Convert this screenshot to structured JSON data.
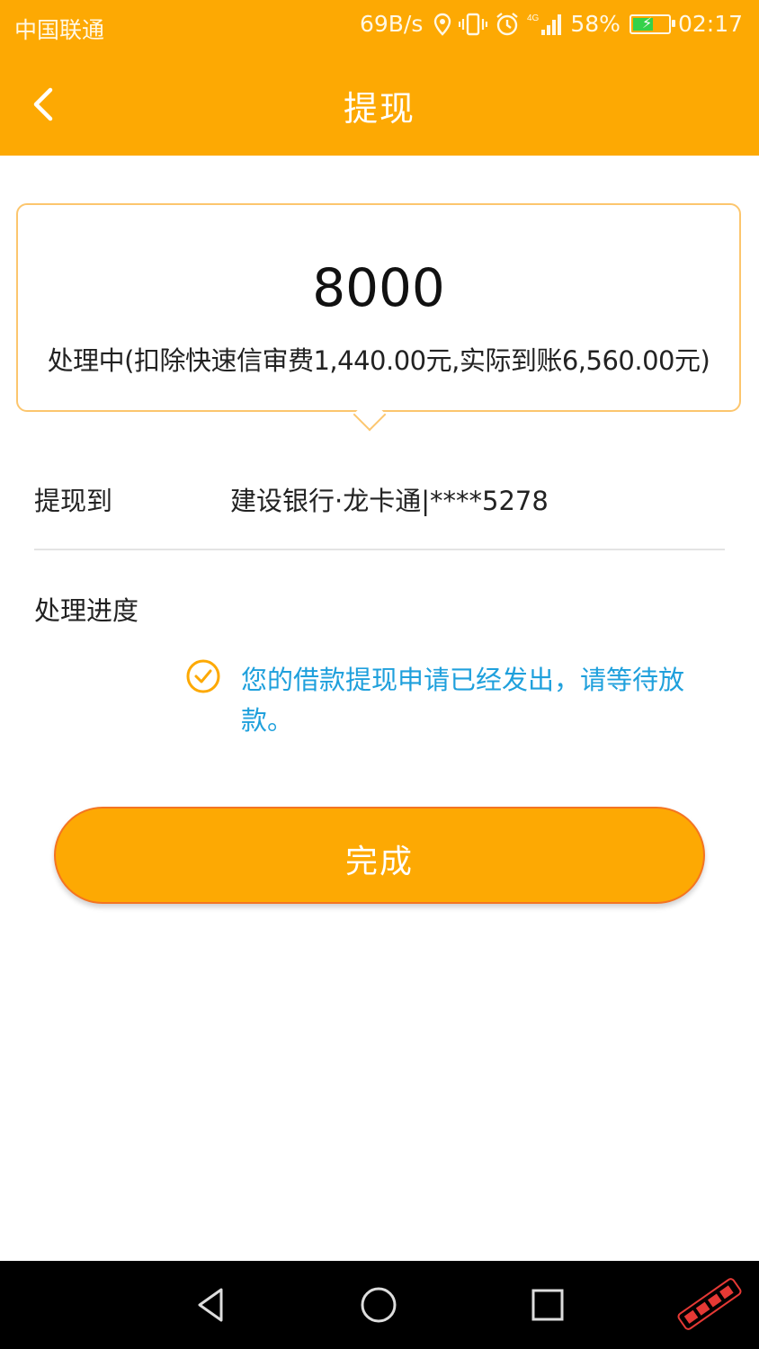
{
  "status_bar": {
    "carrier": "中国联通",
    "speed": "69B/s",
    "signal_label": "4G",
    "battery_percent": "58%",
    "battery_level": 0.58,
    "time": "02:17"
  },
  "header": {
    "title": "提现",
    "back_icon": "chevron-left-icon",
    "color": "#fda903"
  },
  "amount_card": {
    "amount": "8000",
    "status_text": "处理中(扣除快速信审费1,440.00元,实际到账6,560.00元)",
    "border_color": "#fcc66e"
  },
  "withdraw_to": {
    "label": "提现到",
    "value": "建设银行·龙卡通|****5278"
  },
  "progress": {
    "label": "处理进度",
    "step_icon": "check-circle-icon",
    "step_text": "您的借款提现申请已经发出，请等待放款。",
    "text_color": "#1fa0dc"
  },
  "done_button": {
    "label": "完成",
    "color": "#fda903",
    "border_color": "#f47421"
  },
  "nav_bar": {
    "back_icon": "triangle-back-icon",
    "home_icon": "circle-home-icon",
    "recent_icon": "square-recent-icon",
    "watermark_icon": "forum-watermark-logo"
  }
}
